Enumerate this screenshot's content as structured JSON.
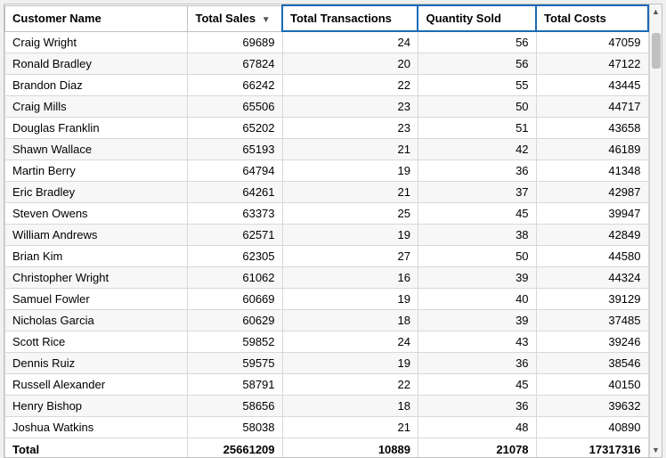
{
  "table": {
    "columns": [
      {
        "key": "customer_name",
        "label": "Customer Name",
        "highlighted": false,
        "sortable": true
      },
      {
        "key": "total_sales",
        "label": "Total Sales",
        "highlighted": false,
        "sortable": true,
        "sort_dir": "desc"
      },
      {
        "key": "total_transactions",
        "label": "Total Transactions",
        "highlighted": true,
        "sortable": false
      },
      {
        "key": "quantity_sold",
        "label": "Quantity Sold",
        "highlighted": true,
        "sortable": false
      },
      {
        "key": "total_costs",
        "label": "Total Costs",
        "highlighted": true,
        "sortable": false
      }
    ],
    "rows": [
      {
        "customer_name": "Craig Wright",
        "total_sales": "69689",
        "total_transactions": "24",
        "quantity_sold": "56",
        "total_costs": "47059"
      },
      {
        "customer_name": "Ronald Bradley",
        "total_sales": "67824",
        "total_transactions": "20",
        "quantity_sold": "56",
        "total_costs": "47122"
      },
      {
        "customer_name": "Brandon Diaz",
        "total_sales": "66242",
        "total_transactions": "22",
        "quantity_sold": "55",
        "total_costs": "43445"
      },
      {
        "customer_name": "Craig Mills",
        "total_sales": "65506",
        "total_transactions": "23",
        "quantity_sold": "50",
        "total_costs": "44717"
      },
      {
        "customer_name": "Douglas Franklin",
        "total_sales": "65202",
        "total_transactions": "23",
        "quantity_sold": "51",
        "total_costs": "43658"
      },
      {
        "customer_name": "Shawn Wallace",
        "total_sales": "65193",
        "total_transactions": "21",
        "quantity_sold": "42",
        "total_costs": "46189"
      },
      {
        "customer_name": "Martin Berry",
        "total_sales": "64794",
        "total_transactions": "19",
        "quantity_sold": "36",
        "total_costs": "41348"
      },
      {
        "customer_name": "Eric Bradley",
        "total_sales": "64261",
        "total_transactions": "21",
        "quantity_sold": "37",
        "total_costs": "42987"
      },
      {
        "customer_name": "Steven Owens",
        "total_sales": "63373",
        "total_transactions": "25",
        "quantity_sold": "45",
        "total_costs": "39947"
      },
      {
        "customer_name": "William Andrews",
        "total_sales": "62571",
        "total_transactions": "19",
        "quantity_sold": "38",
        "total_costs": "42849"
      },
      {
        "customer_name": "Brian Kim",
        "total_sales": "62305",
        "total_transactions": "27",
        "quantity_sold": "50",
        "total_costs": "44580"
      },
      {
        "customer_name": "Christopher Wright",
        "total_sales": "61062",
        "total_transactions": "16",
        "quantity_sold": "39",
        "total_costs": "44324"
      },
      {
        "customer_name": "Samuel Fowler",
        "total_sales": "60669",
        "total_transactions": "19",
        "quantity_sold": "40",
        "total_costs": "39129"
      },
      {
        "customer_name": "Nicholas Garcia",
        "total_sales": "60629",
        "total_transactions": "18",
        "quantity_sold": "39",
        "total_costs": "37485"
      },
      {
        "customer_name": "Scott Rice",
        "total_sales": "59852",
        "total_transactions": "24",
        "quantity_sold": "43",
        "total_costs": "39246"
      },
      {
        "customer_name": "Dennis Ruiz",
        "total_sales": "59575",
        "total_transactions": "19",
        "quantity_sold": "36",
        "total_costs": "38546"
      },
      {
        "customer_name": "Russell Alexander",
        "total_sales": "58791",
        "total_transactions": "22",
        "quantity_sold": "45",
        "total_costs": "40150"
      },
      {
        "customer_name": "Henry Bishop",
        "total_sales": "58656",
        "total_transactions": "18",
        "quantity_sold": "36",
        "total_costs": "39632"
      },
      {
        "customer_name": "Joshua Watkins",
        "total_sales": "58038",
        "total_transactions": "21",
        "quantity_sold": "48",
        "total_costs": "40890"
      }
    ],
    "footer": {
      "label": "Total",
      "total_sales": "25661209",
      "total_transactions": "10889",
      "quantity_sold": "21078",
      "total_costs": "17317316"
    }
  },
  "scrollbar": {
    "up_arrow": "▲",
    "down_arrow": "▼"
  }
}
